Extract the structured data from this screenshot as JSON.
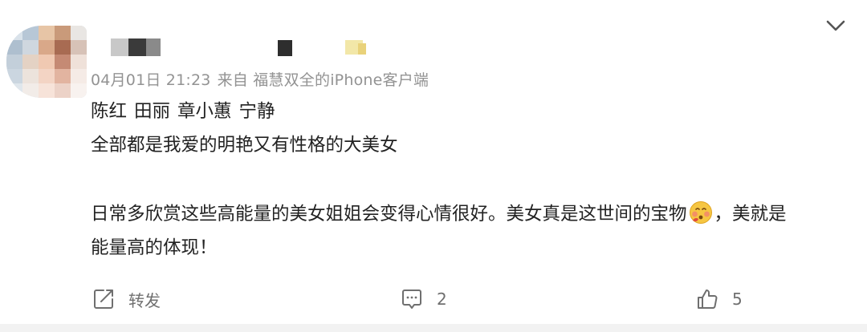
{
  "comment": {
    "timestamp": "04月01日 21:23",
    "source": "来自 福慧双全的iPhone客户端",
    "names": [
      "陈红",
      "田丽",
      "章小蕙",
      "宁静"
    ],
    "line1": "全部都是我爱的明艳又有性格的大美女",
    "line2_before": "日常多欣赏这些高能量的美女姐姐会变得心情很好。美女真是这世间的宝物",
    "line2_after": "，美就是",
    "line3": "能量高的体现！"
  },
  "actions": {
    "repost_label": "转发",
    "comment_count": "2",
    "like_count": "5"
  },
  "icons": {
    "menu": "chevron-down-icon",
    "repost": "share-icon",
    "comment": "comment-icon",
    "like": "thumbs-up-icon",
    "emoji": "blushing-face-emoji"
  },
  "colors": {
    "text": "#222222",
    "meta": "#939393",
    "icon": "#6f6f6f"
  }
}
